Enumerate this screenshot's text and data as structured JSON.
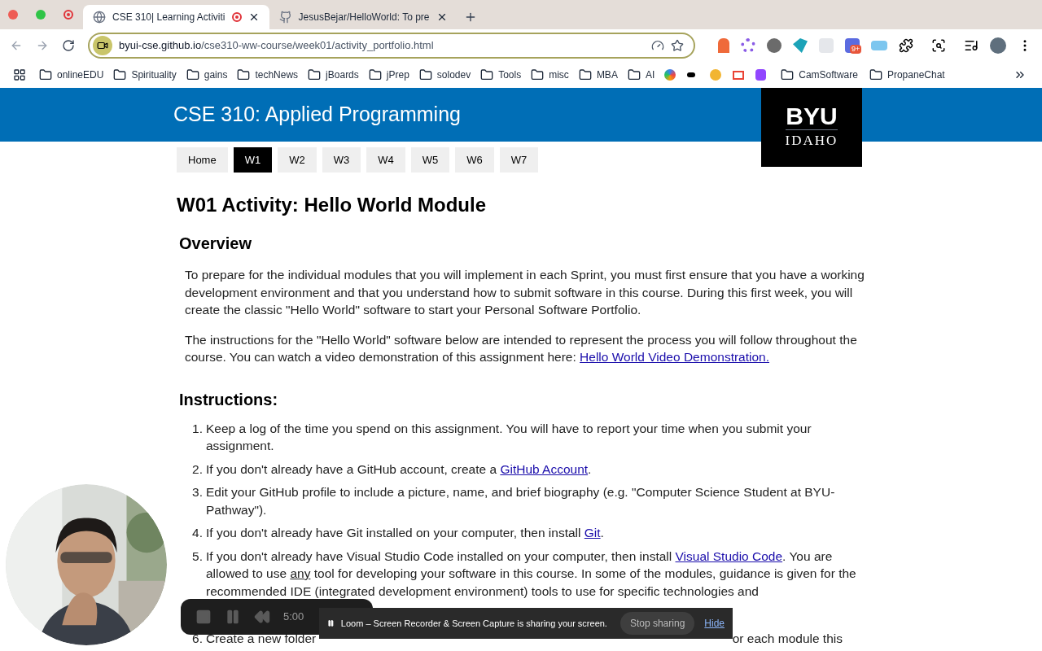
{
  "browser": {
    "tabs": [
      {
        "title": "CSE 310| Learning Activiti",
        "recording": true,
        "selected": true
      },
      {
        "title": "JesusBejar/HelloWorld: To pre",
        "recording": false,
        "selected": false
      }
    ],
    "url_host": "byui-cse.github.io",
    "url_path": "/cse310-ww-course/week01/activity_portfolio.html",
    "extension_badge": "9+",
    "bookmarks_left": [
      "onlineEDU",
      "Spirituality",
      "gains",
      "techNews",
      "jBoards",
      "jPrep",
      "solodev",
      "Tools",
      "misc",
      "MBA",
      "AI"
    ],
    "bookmarks_right": [
      "CamSoftware",
      "PropaneChat"
    ]
  },
  "header": {
    "title": "CSE 310: Applied Programming",
    "logo_top": "BYU",
    "logo_bottom": "IDAHO"
  },
  "nav": [
    {
      "label": "Home",
      "selected": false
    },
    {
      "label": "W1",
      "selected": true
    },
    {
      "label": "W2",
      "selected": false
    },
    {
      "label": "W3",
      "selected": false
    },
    {
      "label": "W4",
      "selected": false
    },
    {
      "label": "W5",
      "selected": false
    },
    {
      "label": "W6",
      "selected": false
    },
    {
      "label": "W7",
      "selected": false
    }
  ],
  "heading": "W01 Activity: Hello World Module",
  "overview_heading": "Overview",
  "overview": [
    [
      {
        "kind": "text",
        "text": "To prepare for the individual modules that you will implement in each Sprint, you must first ensure that you have a working development environment and that you understand how to submit software in this course.  During this first week, you will create the classic \"Hello World\" software to start your Personal Software Portfolio."
      }
    ],
    [
      {
        "kind": "text",
        "text": "The instructions for the \"Hello World\" software below are intended to represent the process you will follow throughout the course.  You can watch a video demonstration of this assignment here: "
      },
      {
        "kind": "link",
        "text": "Hello World Video Demonstration."
      }
    ]
  ],
  "instructions_heading": "Instructions:",
  "steps": [
    {
      "number": "1.",
      "parts": [
        {
          "kind": "text",
          "text": "Keep a log of the time you spend on this assignment.  You will have to report your time when you submit your assignment."
        }
      ]
    },
    {
      "number": "2.",
      "parts": [
        {
          "kind": "text",
          "text": "If you don't already have a GitHub account, create a "
        },
        {
          "kind": "link",
          "text": "GitHub Account"
        },
        {
          "kind": "text",
          "text": "."
        }
      ]
    },
    {
      "number": "3.",
      "parts": [
        {
          "kind": "text",
          "text": "Edit your GitHub profile to include a picture, name, and brief biography (e.g. \"Computer Science Student at BYU-Pathway\")."
        }
      ]
    },
    {
      "number": "4.",
      "parts": [
        {
          "kind": "text",
          "text": "If you don't already have Git installed on your computer, then install "
        },
        {
          "kind": "link",
          "text": "Git"
        },
        {
          "kind": "text",
          "text": "."
        }
      ]
    },
    {
      "number": "5.",
      "parts": [
        {
          "kind": "text",
          "text": "If you don't already have Visual Studio Code installed on your computer, then install "
        },
        {
          "kind": "link",
          "text": "Visual Studio Code"
        },
        {
          "kind": "text",
          "text": ".  You are allowed to use "
        },
        {
          "kind": "underline",
          "text": "any"
        },
        {
          "kind": "text",
          "text": " tool for developing your software in this course.  In some of the modules,  guidance is given for the recommended IDE (integrated development environment) tools to use for specific technologies and"
        }
      ]
    }
  ],
  "step6": {
    "number": "6.",
    "start": "Create a new folder",
    "end": "or each module this"
  },
  "recorder": {
    "time": "5:00"
  },
  "sharing": {
    "message": "Loom – Screen Recorder & Screen Capture is sharing your screen.",
    "stop": "Stop sharing",
    "hide": "Hide"
  }
}
